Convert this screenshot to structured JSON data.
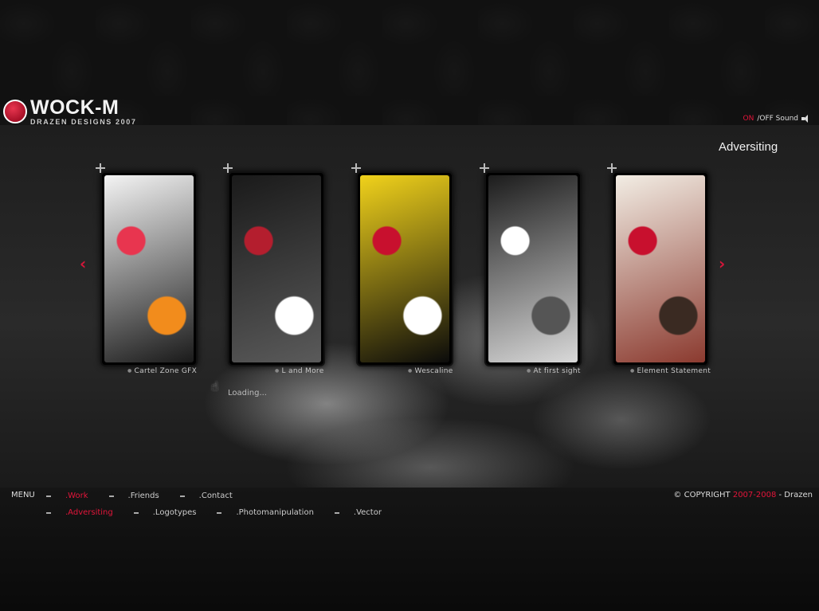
{
  "logo": {
    "title": "WOCK-M",
    "subtitle": "DRAZEN DESIGNS 2007"
  },
  "sound": {
    "on": "ON",
    "rest": "/OFF Sound"
  },
  "section_title": "Adversiting",
  "nav": {
    "prev_arrow": "‹",
    "next_arrow": "›"
  },
  "gallery": [
    {
      "caption": "Cartel Zone GFX",
      "colors": [
        "#f4f4f4",
        "#1a1a1a",
        "#e8354f",
        "#f28c1c"
      ]
    },
    {
      "caption": "L and More",
      "colors": [
        "#1a1a1a",
        "#5a5a5a",
        "#b41e2e",
        "#ffffff"
      ]
    },
    {
      "caption": "Wescaline",
      "colors": [
        "#f1d21b",
        "#0b0b0b",
        "#c8102e",
        "#ffffff"
      ]
    },
    {
      "caption": "At first sight",
      "colors": [
        "#1c1c1c",
        "#d9d9d9",
        "#ffffff",
        "#555555"
      ]
    },
    {
      "caption": "Element Statement",
      "colors": [
        "#f2ede4",
        "#8b3a2f",
        "#c8102e",
        "#3a2a22"
      ]
    }
  ],
  "loading_text": "Loading...",
  "menu": {
    "label": "MENU",
    "row1": [
      {
        "label": ".Work",
        "active": true
      },
      {
        "label": ".Friends",
        "active": false
      },
      {
        "label": ".Contact",
        "active": false
      }
    ],
    "row2": [
      {
        "label": ".Adversiting",
        "active": true
      },
      {
        "label": ".Logotypes",
        "active": false
      },
      {
        "label": ".Photomanipulation",
        "active": false
      },
      {
        "label": ".Vector",
        "active": false
      }
    ]
  },
  "copyright": {
    "prefix": "© COPYRIGHT ",
    "years": "2007-2008",
    "suffix": " - Drazen"
  },
  "accent_color": "#e3153a"
}
